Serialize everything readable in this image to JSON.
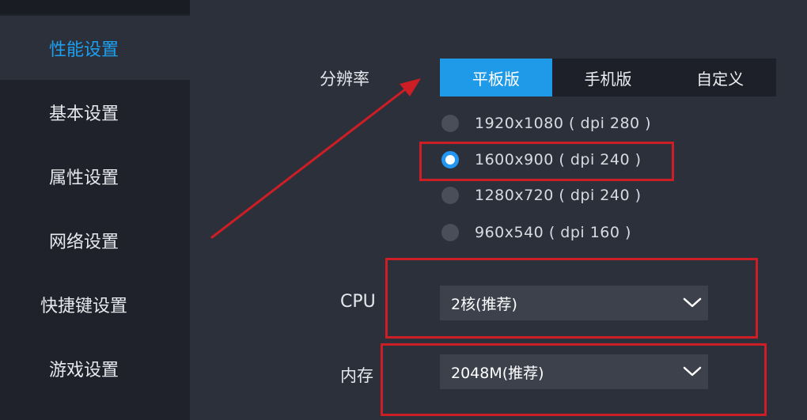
{
  "sidebar": {
    "items": [
      {
        "label": "性能设置",
        "active": true
      },
      {
        "label": "基本设置",
        "active": false
      },
      {
        "label": "属性设置",
        "active": false
      },
      {
        "label": "网络设置",
        "active": false
      },
      {
        "label": "快捷键设置",
        "active": false
      },
      {
        "label": "游戏设置",
        "active": false
      }
    ]
  },
  "resolution": {
    "label": "分辨率",
    "tabs": [
      {
        "label": "平板版",
        "active": true
      },
      {
        "label": "手机版",
        "active": false
      },
      {
        "label": "自定义",
        "active": false
      }
    ],
    "options": [
      {
        "label": "1920x1080 ( dpi 280 )",
        "checked": false
      },
      {
        "label": "1600x900 ( dpi 240 )",
        "checked": true
      },
      {
        "label": "1280x720 ( dpi 240 )",
        "checked": false
      },
      {
        "label": "960x540 ( dpi 160 )",
        "checked": false
      }
    ]
  },
  "cpu": {
    "label": "CPU",
    "value": "2核(推荐)"
  },
  "memory": {
    "label": "内存",
    "value": "2048M(推荐)"
  },
  "colors": {
    "accent": "#1e9ae8",
    "annotation_red": "#cc1e24",
    "sidebar_bg": "#1f222a",
    "panel_bg": "#2c303b"
  }
}
